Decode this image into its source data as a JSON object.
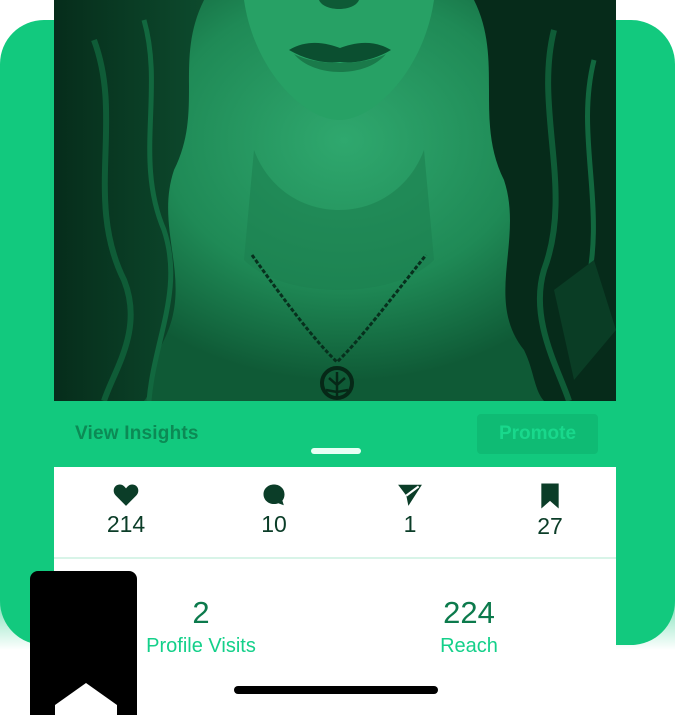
{
  "post": {
    "image_icon": "portrait-illustration-green"
  },
  "insights_bar": {
    "view_insights_label": "View Insights",
    "promote_label": "Promote"
  },
  "stats": {
    "likes": {
      "icon": "heart-icon",
      "value": "214"
    },
    "comments": {
      "icon": "comment-icon",
      "value": "10"
    },
    "shares": {
      "icon": "send-icon",
      "value": "1"
    },
    "saves": {
      "icon": "bookmark-icon",
      "value": "27"
    }
  },
  "detail": {
    "profile_visits": {
      "value": "2",
      "label": "Profile Visits"
    },
    "reach": {
      "value": "224",
      "label": "Reach"
    }
  },
  "colors": {
    "accent": "#12c97e",
    "accent_dark": "#0c7a4c",
    "accent_light": "#14d08a",
    "icon_dark": "#0b3d28"
  }
}
